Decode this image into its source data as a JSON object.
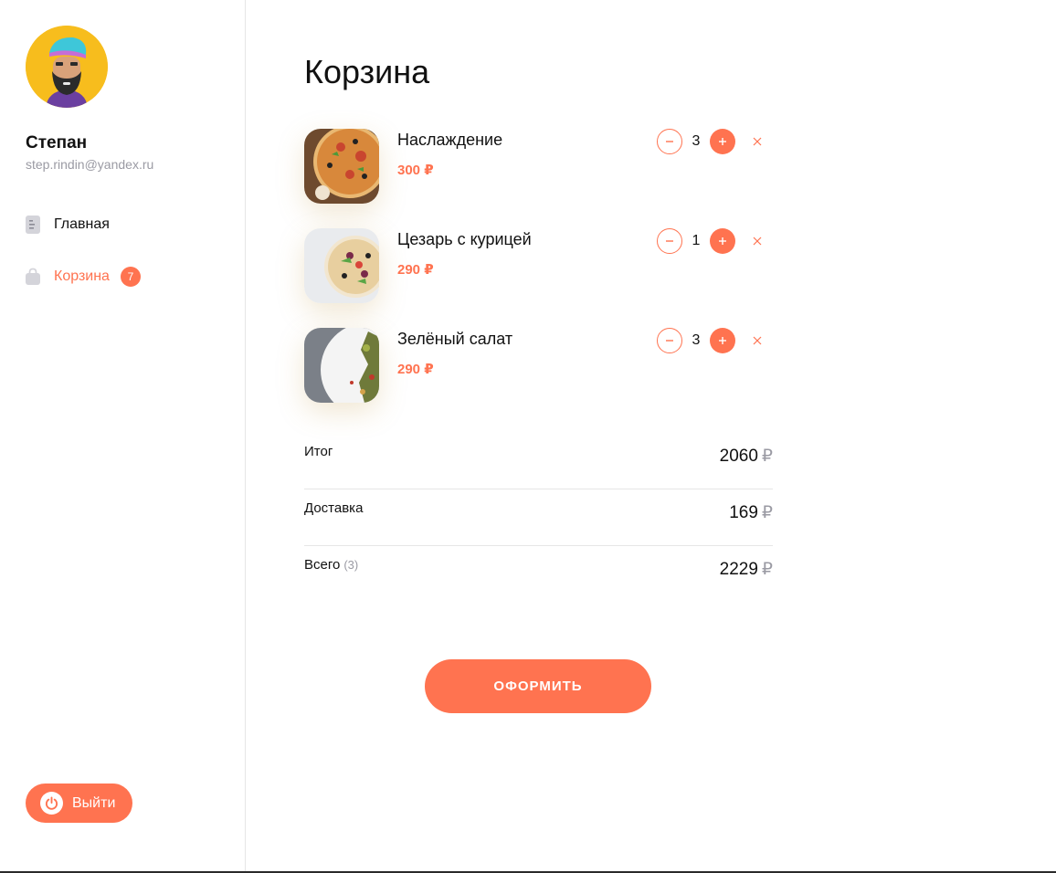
{
  "user": {
    "name": "Степан",
    "email": "step.rindin@yandex.ru"
  },
  "nav": {
    "home_label": "Главная",
    "cart_label": "Корзина",
    "cart_badge": "7"
  },
  "logout_label": "Выйти",
  "page_title": "Корзина",
  "items": [
    {
      "name": "Наслаждение",
      "price": "300 ₽",
      "qty": "3",
      "image": "pizza-photo"
    },
    {
      "name": "Цезарь с курицей",
      "price": "290 ₽",
      "qty": "1",
      "image": "caesar-pizza-photo"
    },
    {
      "name": "Зелёный салат",
      "price": "290 ₽",
      "qty": "3",
      "image": "green-salad-photo"
    }
  ],
  "summary": {
    "subtotal_label": "Итог",
    "subtotal_value": "2060",
    "delivery_label": "Доставка",
    "delivery_value": "169",
    "total_label": "Всего",
    "total_count": "(3)",
    "total_value": "2229",
    "currency": "₽"
  },
  "checkout_label": "ОФОРМИТЬ",
  "colors": {
    "accent": "#ff7350",
    "avatar_bg": "#f7bd1d",
    "muted": "#9a9aa3"
  }
}
